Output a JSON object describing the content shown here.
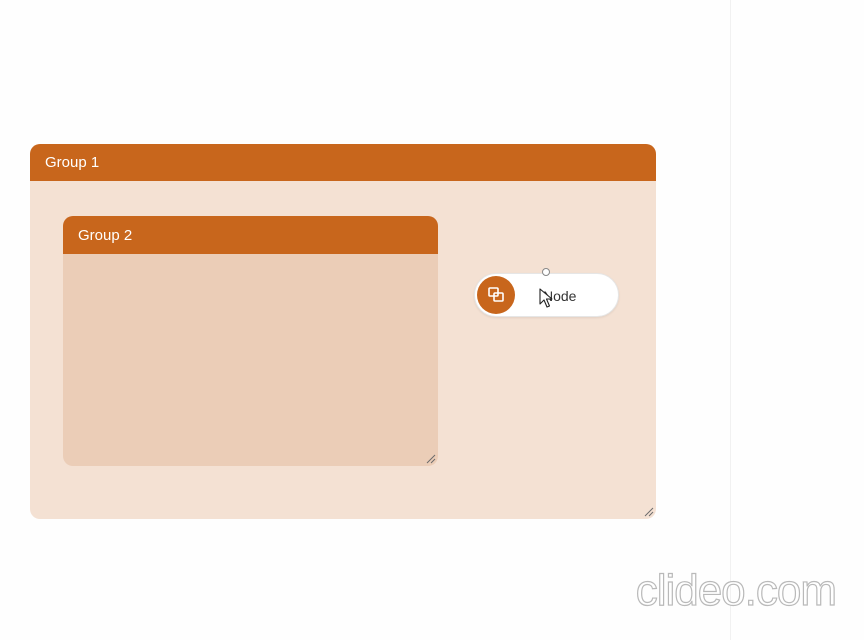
{
  "groups": [
    {
      "title": "Group 1"
    },
    {
      "title": "Group 2"
    }
  ],
  "node": {
    "label": "Node",
    "icon": "group-icon"
  },
  "watermark": "clideo.com",
  "colors": {
    "accent": "#c8661c",
    "group1_fill": "#f4e1d3",
    "group2_fill": "#ebcdb7",
    "background": "#fefefe"
  }
}
